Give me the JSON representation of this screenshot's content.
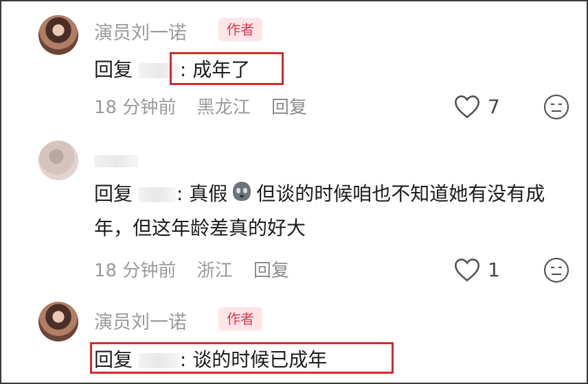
{
  "comments": [
    {
      "username": "演员刘一诺",
      "badge": "作者",
      "reply_prefix": "回复",
      "text": ": 成年了",
      "time": "18 分钟前",
      "location": "黑龙江",
      "reply_label": "回复",
      "likes": "7"
    },
    {
      "username": "",
      "reply_prefix": "回复",
      "text_part1": ": 真假",
      "text_part2": "但谈的时候咱也不知道她有没有成年，但这年龄差真的好大",
      "time": "18 分钟前",
      "location": "浙江",
      "reply_label": "回复",
      "likes": "1"
    },
    {
      "username": "演员刘一诺",
      "badge": "作者",
      "reply_prefix": "回复",
      "text": ": 谈的时候已成年"
    }
  ],
  "icons": {
    "like": "heart-outline-icon",
    "dislike": "neutral-face-icon",
    "emoji": "ghost-emoji-icon"
  },
  "colors": {
    "badge_text": "#e2364e",
    "badge_bg": "#fde5e8",
    "highlight_box": "#d42a2a"
  }
}
